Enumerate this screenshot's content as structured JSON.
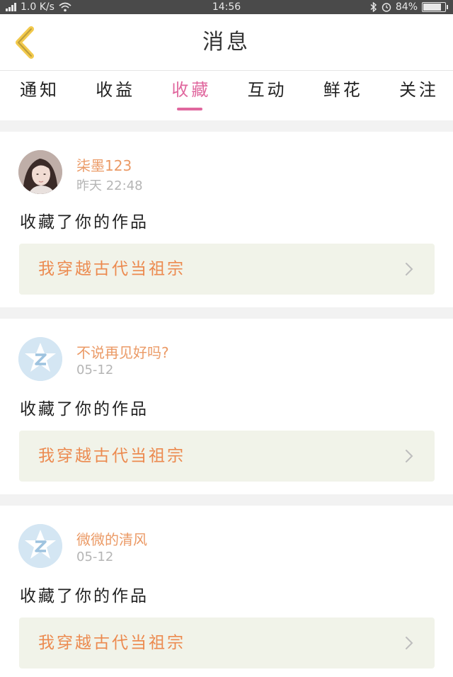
{
  "status_bar": {
    "speed": "1.0 K/s",
    "time": "14:56",
    "battery_percent": "84%",
    "battery_level": 0.84
  },
  "nav": {
    "title": "消息"
  },
  "tabs": [
    {
      "label": "通知",
      "active": false
    },
    {
      "label": "收益",
      "active": false
    },
    {
      "label": "收藏",
      "active": true
    },
    {
      "label": "互动",
      "active": false
    },
    {
      "label": "鲜花",
      "active": false
    },
    {
      "label": "关注",
      "active": false
    }
  ],
  "feed": [
    {
      "user": "柒墨123",
      "time": "昨天 22:48",
      "action": "收藏了你的作品",
      "work_title": "我穿越古代当祖宗",
      "avatar": "photo"
    },
    {
      "user": "不说再见好吗?",
      "time": "05-12",
      "action": "收藏了你的作品",
      "work_title": "我穿越古代当祖宗",
      "avatar": "default"
    },
    {
      "user": "微微的清风",
      "time": "05-12",
      "action": "收藏了你的作品",
      "work_title": "我穿越古代当祖宗",
      "avatar": "default"
    }
  ],
  "colors": {
    "accent": "#e0679e",
    "name": "#eb9a66",
    "work_title": "#ec8a4f",
    "back_arrow": "#f2c94c"
  }
}
